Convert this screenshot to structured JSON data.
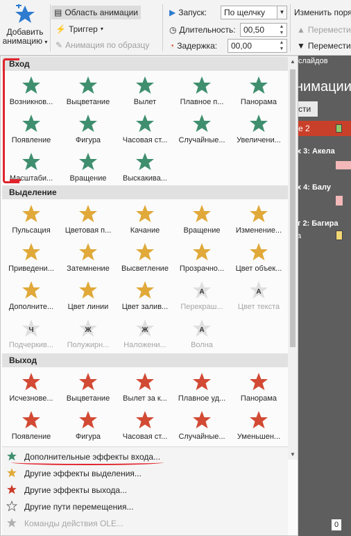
{
  "ribbon": {
    "add_animation": "Добавить анимацию",
    "animation_pane": "Область анимации",
    "trigger": "Триггер",
    "animation_painter": "Анимация по образцу",
    "start_label": "Запуск:",
    "start_value": "По щелчку",
    "duration_label": "Длительность:",
    "duration_value": "00,50",
    "delay_label": "Задержка:",
    "delay_value": "00,00",
    "reorder_label": "Изменить поря",
    "move_earlier": "Перемести",
    "move_later": "Перемести"
  },
  "right_pane": {
    "slides": "слайдов",
    "title": "нимации",
    "tab": "сти",
    "item1": "е 2",
    "item2": "х 3: Акела",
    "item3": "х 4: Балу",
    "item4": "т 2: Багира",
    "item5": "а",
    "bottom": "0"
  },
  "sections": {
    "entrance": "Вход",
    "emphasis": "Выделение",
    "exit": "Выход"
  },
  "entrance": [
    {
      "label": "Возникнов...",
      "icon": "appear-icon"
    },
    {
      "label": "Выцветание",
      "icon": "fade-icon"
    },
    {
      "label": "Вылет",
      "icon": "fly-in-icon"
    },
    {
      "label": "Плавное п...",
      "icon": "float-in-icon"
    },
    {
      "label": "Панорама",
      "icon": "split-icon"
    },
    {
      "label": "Появление",
      "icon": "wipe-icon"
    },
    {
      "label": "Фигура",
      "icon": "shape-icon"
    },
    {
      "label": "Часовая ст...",
      "icon": "wheel-icon"
    },
    {
      "label": "Случайные...",
      "icon": "random-bars-icon"
    },
    {
      "label": "Увеличени...",
      "icon": "grow-turn-icon"
    },
    {
      "label": "Масштаби...",
      "icon": "zoom-icon"
    },
    {
      "label": "Вращение",
      "icon": "swivel-icon"
    },
    {
      "label": "Выскакива...",
      "icon": "bounce-icon"
    }
  ],
  "emphasis": [
    {
      "label": "Пульсация",
      "icon": "pulse-icon",
      "dis": false
    },
    {
      "label": "Цветовая п...",
      "icon": "color-pulse-icon",
      "dis": false
    },
    {
      "label": "Качание",
      "icon": "teeter-icon",
      "dis": false
    },
    {
      "label": "Вращение",
      "icon": "spin-icon",
      "dis": false
    },
    {
      "label": "Изменение...",
      "icon": "grow-shrink-icon",
      "dis": false
    },
    {
      "label": "Приведени...",
      "icon": "desaturate-icon",
      "dis": false
    },
    {
      "label": "Затемнение",
      "icon": "darken-icon",
      "dis": false
    },
    {
      "label": "Высветление",
      "icon": "lighten-icon",
      "dis": false
    },
    {
      "label": "Прозрачно...",
      "icon": "transparency-icon",
      "dis": false
    },
    {
      "label": "Цвет объек...",
      "icon": "object-color-icon",
      "dis": false
    },
    {
      "label": "Дополните...",
      "icon": "complementary-color-icon",
      "dis": false
    },
    {
      "label": "Цвет линии",
      "icon": "line-color-icon",
      "dis": false
    },
    {
      "label": "Цвет залив...",
      "icon": "fill-color-icon",
      "dis": false
    },
    {
      "label": "Перекраш...",
      "icon": "brush-color-icon",
      "dis": true,
      "letter": "A"
    },
    {
      "label": "Цвет текста",
      "icon": "font-color-icon",
      "dis": true,
      "letter": "A"
    },
    {
      "label": "Подчеркив...",
      "icon": "underline-icon",
      "dis": true,
      "letter": "Ч"
    },
    {
      "label": "Полужирн...",
      "icon": "bold-flash-icon",
      "dis": true,
      "letter": "Ж"
    },
    {
      "label": "Наложени...",
      "icon": "bold-reveal-icon",
      "dis": true,
      "letter": "Ж"
    },
    {
      "label": "Волна",
      "icon": "wave-icon",
      "dis": true,
      "letter": "A"
    }
  ],
  "exit": [
    {
      "label": "Исчезнове...",
      "icon": "disappear-icon"
    },
    {
      "label": "Выцветание",
      "icon": "fade-out-icon"
    },
    {
      "label": "Вылет за к...",
      "icon": "fly-out-icon"
    },
    {
      "label": "Плавное уд...",
      "icon": "float-out-icon"
    },
    {
      "label": "Панорама",
      "icon": "split-out-icon"
    },
    {
      "label": "Появление",
      "icon": "wipe-out-icon"
    },
    {
      "label": "Фигура",
      "icon": "shape-out-icon"
    },
    {
      "label": "Часовая ст...",
      "icon": "wheel-out-icon"
    },
    {
      "label": "Случайные...",
      "icon": "random-bars-out-icon"
    },
    {
      "label": "Уменьшен...",
      "icon": "shrink-turn-icon"
    }
  ],
  "menu": [
    {
      "label": "Дополнительные эффекты входа...",
      "icon": "green-star-icon",
      "color": "#3f8f6f",
      "dis": false
    },
    {
      "label": "Другие эффекты выделения...",
      "icon": "gold-star-icon",
      "color": "#e0a93a",
      "dis": false
    },
    {
      "label": "Другие эффекты выхода...",
      "icon": "red-star-icon",
      "color": "#cc3a2a",
      "dis": false
    },
    {
      "label": "Другие пути перемещения...",
      "icon": "outline-star-icon",
      "color": "none",
      "dis": false
    },
    {
      "label": "Команды действия OLE...",
      "icon": "gear-star-icon",
      "color": "#b0b0b0",
      "dis": true
    }
  ],
  "colors": {
    "entrance": "#3f8f6f",
    "emphasis": "#e0a93a",
    "exit": "#d24a34",
    "accent": "#d24726"
  }
}
